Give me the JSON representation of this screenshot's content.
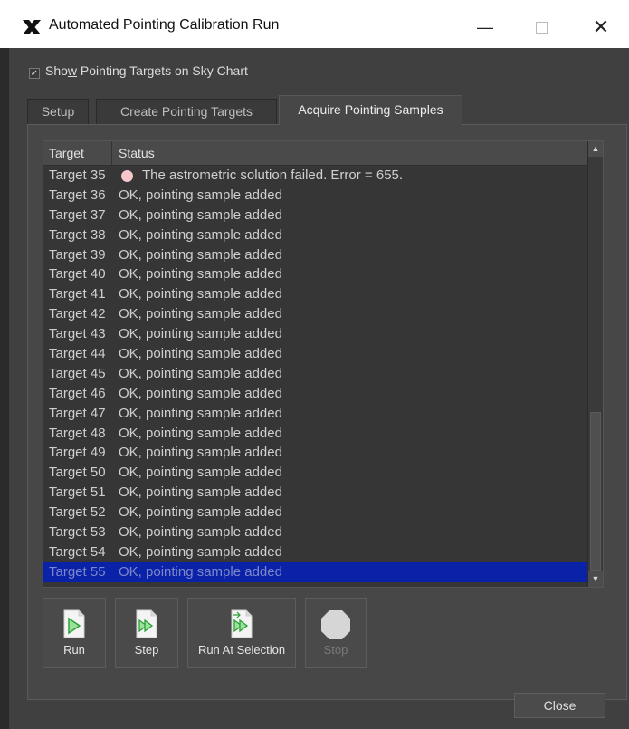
{
  "window": {
    "title": "Automated Pointing Calibration Run",
    "icon": "x-logo-icon",
    "controls": [
      "minimize",
      "maximize",
      "close"
    ]
  },
  "show_targets": {
    "label_prefix": "Sho",
    "label_mnemonic": "w",
    "label_suffix": " Pointing Targets on Sky Chart",
    "checked": true
  },
  "tabs": [
    {
      "label": "Setup",
      "active": false
    },
    {
      "label": "Create Pointing Targets",
      "active": false
    },
    {
      "label": "Acquire Pointing Samples",
      "active": true
    }
  ],
  "table": {
    "columns": [
      "Target",
      "Status"
    ],
    "rows": [
      {
        "target": "Target 35",
        "status": "The astrometric solution failed. Error = 655.",
        "error": true
      },
      {
        "target": "Target 36",
        "status": "OK, pointing sample added"
      },
      {
        "target": "Target 37",
        "status": "OK, pointing sample added"
      },
      {
        "target": "Target 38",
        "status": "OK, pointing sample added"
      },
      {
        "target": "Target 39",
        "status": "OK, pointing sample added"
      },
      {
        "target": "Target 40",
        "status": "OK, pointing sample added"
      },
      {
        "target": "Target 41",
        "status": "OK, pointing sample added"
      },
      {
        "target": "Target 42",
        "status": "OK, pointing sample added"
      },
      {
        "target": "Target 43",
        "status": "OK, pointing sample added"
      },
      {
        "target": "Target 44",
        "status": "OK, pointing sample added"
      },
      {
        "target": "Target 45",
        "status": "OK, pointing sample added"
      },
      {
        "target": "Target 46",
        "status": "OK, pointing sample added"
      },
      {
        "target": "Target 47",
        "status": "OK, pointing sample added"
      },
      {
        "target": "Target 48",
        "status": "OK, pointing sample added"
      },
      {
        "target": "Target 49",
        "status": "OK, pointing sample added"
      },
      {
        "target": "Target 50",
        "status": "OK, pointing sample added"
      },
      {
        "target": "Target 51",
        "status": "OK, pointing sample added"
      },
      {
        "target": "Target 52",
        "status": "OK, pointing sample added"
      },
      {
        "target": "Target 53",
        "status": "OK, pointing sample added"
      },
      {
        "target": "Target 54",
        "status": "OK, pointing sample added"
      },
      {
        "target": "Target 55",
        "status": "OK, pointing sample added",
        "selected": true
      }
    ],
    "selected_color": "#0a22a8",
    "error_dot_color": "#f6c6cc"
  },
  "toolbar": {
    "run_label": "Run",
    "step_label": "Step",
    "run_at_selection_label": "Run At Selection",
    "stop_label": "Stop",
    "stop_enabled": false
  },
  "close_label": "Close"
}
